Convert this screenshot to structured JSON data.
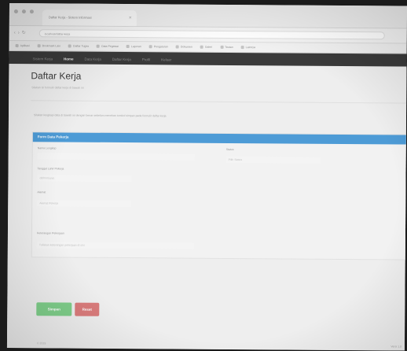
{
  "browser": {
    "tab_title": "Daftar Kerja - Sistem Informasi",
    "url": "localhost/daftar-kerja",
    "bookmarks": [
      "Aplikasi",
      "Bookmark Lain",
      "Daftar Tugas",
      "Data Pegawai",
      "Laporan",
      "Pengaturan",
      "Dokumen",
      "Galeri",
      "Tautan",
      "Lainnya"
    ]
  },
  "navbar": {
    "items": [
      {
        "label": "Sistem Kerja",
        "active": false
      },
      {
        "label": "Home",
        "active": true
      },
      {
        "label": "Data Kerja",
        "active": false
      },
      {
        "label": "Daftar Kerja",
        "active": false
      },
      {
        "label": "Profil",
        "active": false
      },
      {
        "label": "Keluar",
        "active": false
      }
    ]
  },
  "page": {
    "title": "Daftar Kerja",
    "subtitle": "Silakan isi formulir daftar kerja di bawah ini",
    "info": "Silakan lengkapi data di bawah ini dengan benar sebelum menekan tombol simpan pada formulir daftar kerja"
  },
  "form": {
    "heading": "Form Data Pekerja",
    "fields": {
      "nama_label": "Nama Lengkap",
      "nama_value": "",
      "status_label": "Status",
      "status_value": "Pilih Status",
      "tanggal_label": "Tanggal Lahir Pekerja",
      "tanggal_value": "dd/mm/yyyy",
      "alamat_label": "Alamat",
      "alamat_value": "Alamat Pekerja",
      "keterangan_label": "Keterangan Pekerjaan",
      "keterangan_value": "Tuliskan keterangan pekerjaan di sini"
    },
    "submit_label": "Simpan",
    "reset_label": "Reset"
  },
  "footer": {
    "text": "© 2019",
    "corner": "Versi 1.0"
  }
}
